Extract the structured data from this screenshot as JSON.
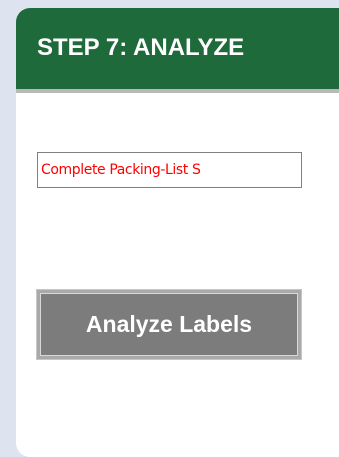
{
  "panel": {
    "title": "STEP 7: ANALYZE",
    "status_text": "Complete Packing-List S",
    "analyze_button_label": "Analyze Labels"
  },
  "colors": {
    "header_bg": "#1e6a3a",
    "status_text": "#ff0000",
    "button_bg": "#7c7c7c"
  }
}
